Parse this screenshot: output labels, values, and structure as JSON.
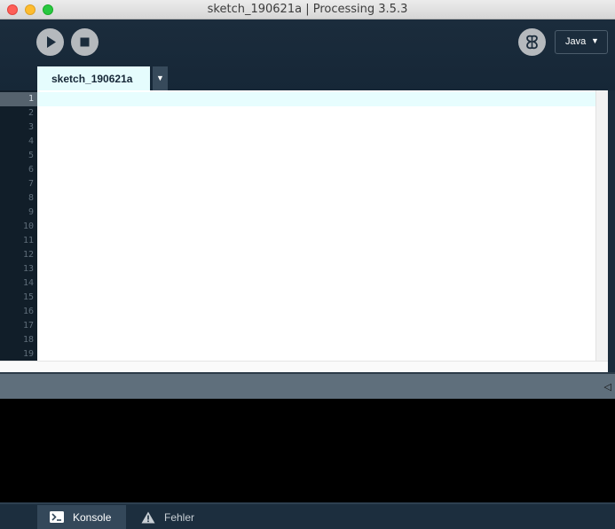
{
  "window": {
    "title": "sketch_190621a | Processing 3.5.3"
  },
  "toolbar": {
    "run_icon": "play-icon",
    "stop_icon": "stop-icon",
    "debug_icon": "butterfly-debugger-icon",
    "mode": "Java",
    "mode_arrow": "▼"
  },
  "tabs": [
    {
      "label": "sketch_190621a",
      "active": true
    }
  ],
  "tab_menu_arrow": "▼",
  "editor": {
    "current_line": 1,
    "line_numbers": [
      "1",
      "2",
      "3",
      "4",
      "5",
      "6",
      "7",
      "8",
      "9",
      "10",
      "11",
      "12",
      "13",
      "14",
      "15",
      "16",
      "17",
      "18",
      "19"
    ]
  },
  "console": {
    "collapse_arrow": "◁"
  },
  "footer": {
    "tabs": [
      {
        "label": "Konsole",
        "icon": "terminal-icon",
        "active": true
      },
      {
        "label": "Fehler",
        "icon": "warning-icon",
        "active": false
      }
    ]
  },
  "colors": {
    "toolbar_bg": "#1b2c3c",
    "tab_active": "#e5fcfd",
    "current_line": "#e7fdfe",
    "console_bg": "#000000"
  }
}
